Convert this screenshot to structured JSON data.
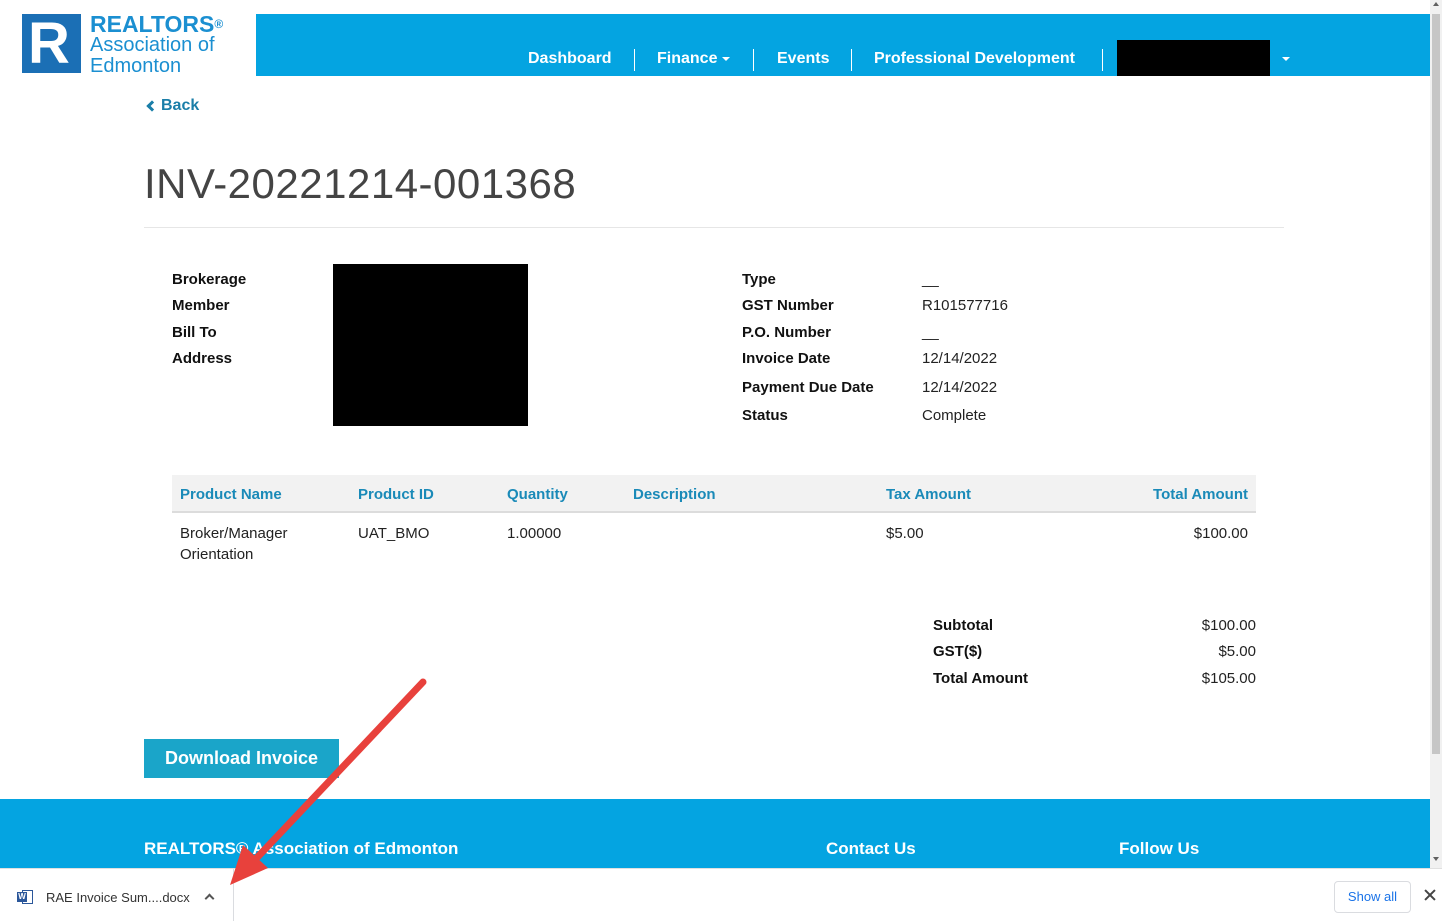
{
  "header": {
    "logo": {
      "line1": "REALTORS",
      "reg": "®",
      "line2": "Association of",
      "line3": "Edmonton",
      "mark": "R"
    },
    "nav": [
      {
        "label": "Dashboard"
      },
      {
        "label": "Finance"
      },
      {
        "label": "Events"
      },
      {
        "label": "Professional Development"
      }
    ]
  },
  "back_label": "Back",
  "invoice": {
    "number": "INV-20221214-001368",
    "left_labels": [
      "Brokerage",
      "Member",
      "Bill To",
      "Address"
    ],
    "right": [
      {
        "label": "Type",
        "value": "__"
      },
      {
        "label": "GST Number",
        "value": "R101577716"
      },
      {
        "label": "P.O. Number",
        "value": "__"
      },
      {
        "label": "Invoice Date",
        "value": "12/14/2022"
      },
      {
        "label": "Payment Due Date",
        "value": "12/14/2022"
      },
      {
        "label": "Status",
        "value": "Complete"
      }
    ]
  },
  "table": {
    "headers": [
      "Product Name",
      "Product ID",
      "Quantity",
      "Description",
      "Tax Amount",
      "Total Amount"
    ],
    "rows": [
      {
        "name_line1": "Broker/Manager",
        "name_line2": "Orientation",
        "id": "UAT_BMO",
        "quantity": "1.00000",
        "description": "",
        "tax": "$5.00",
        "total": "$100.00"
      }
    ]
  },
  "summary": [
    {
      "label": "Subtotal",
      "value": "$100.00"
    },
    {
      "label": "GST($)",
      "value": "$5.00"
    },
    {
      "label": "Total Amount",
      "value": "$105.00"
    }
  ],
  "download_button": "Download Invoice",
  "footer": {
    "org": "REALTORS® Association of Edmonton",
    "contact": "Contact Us",
    "follow": "Follow Us"
  },
  "download_bar": {
    "file_name": "RAE Invoice Sum....docx",
    "show_all": "Show all"
  },
  "colors": {
    "nav_bg": "#04a4e1",
    "brand_blue": "#1b6fb5",
    "link_teal": "#1a7ea8",
    "button": "#1aa5c9",
    "annotation_arrow": "#e8413c"
  }
}
